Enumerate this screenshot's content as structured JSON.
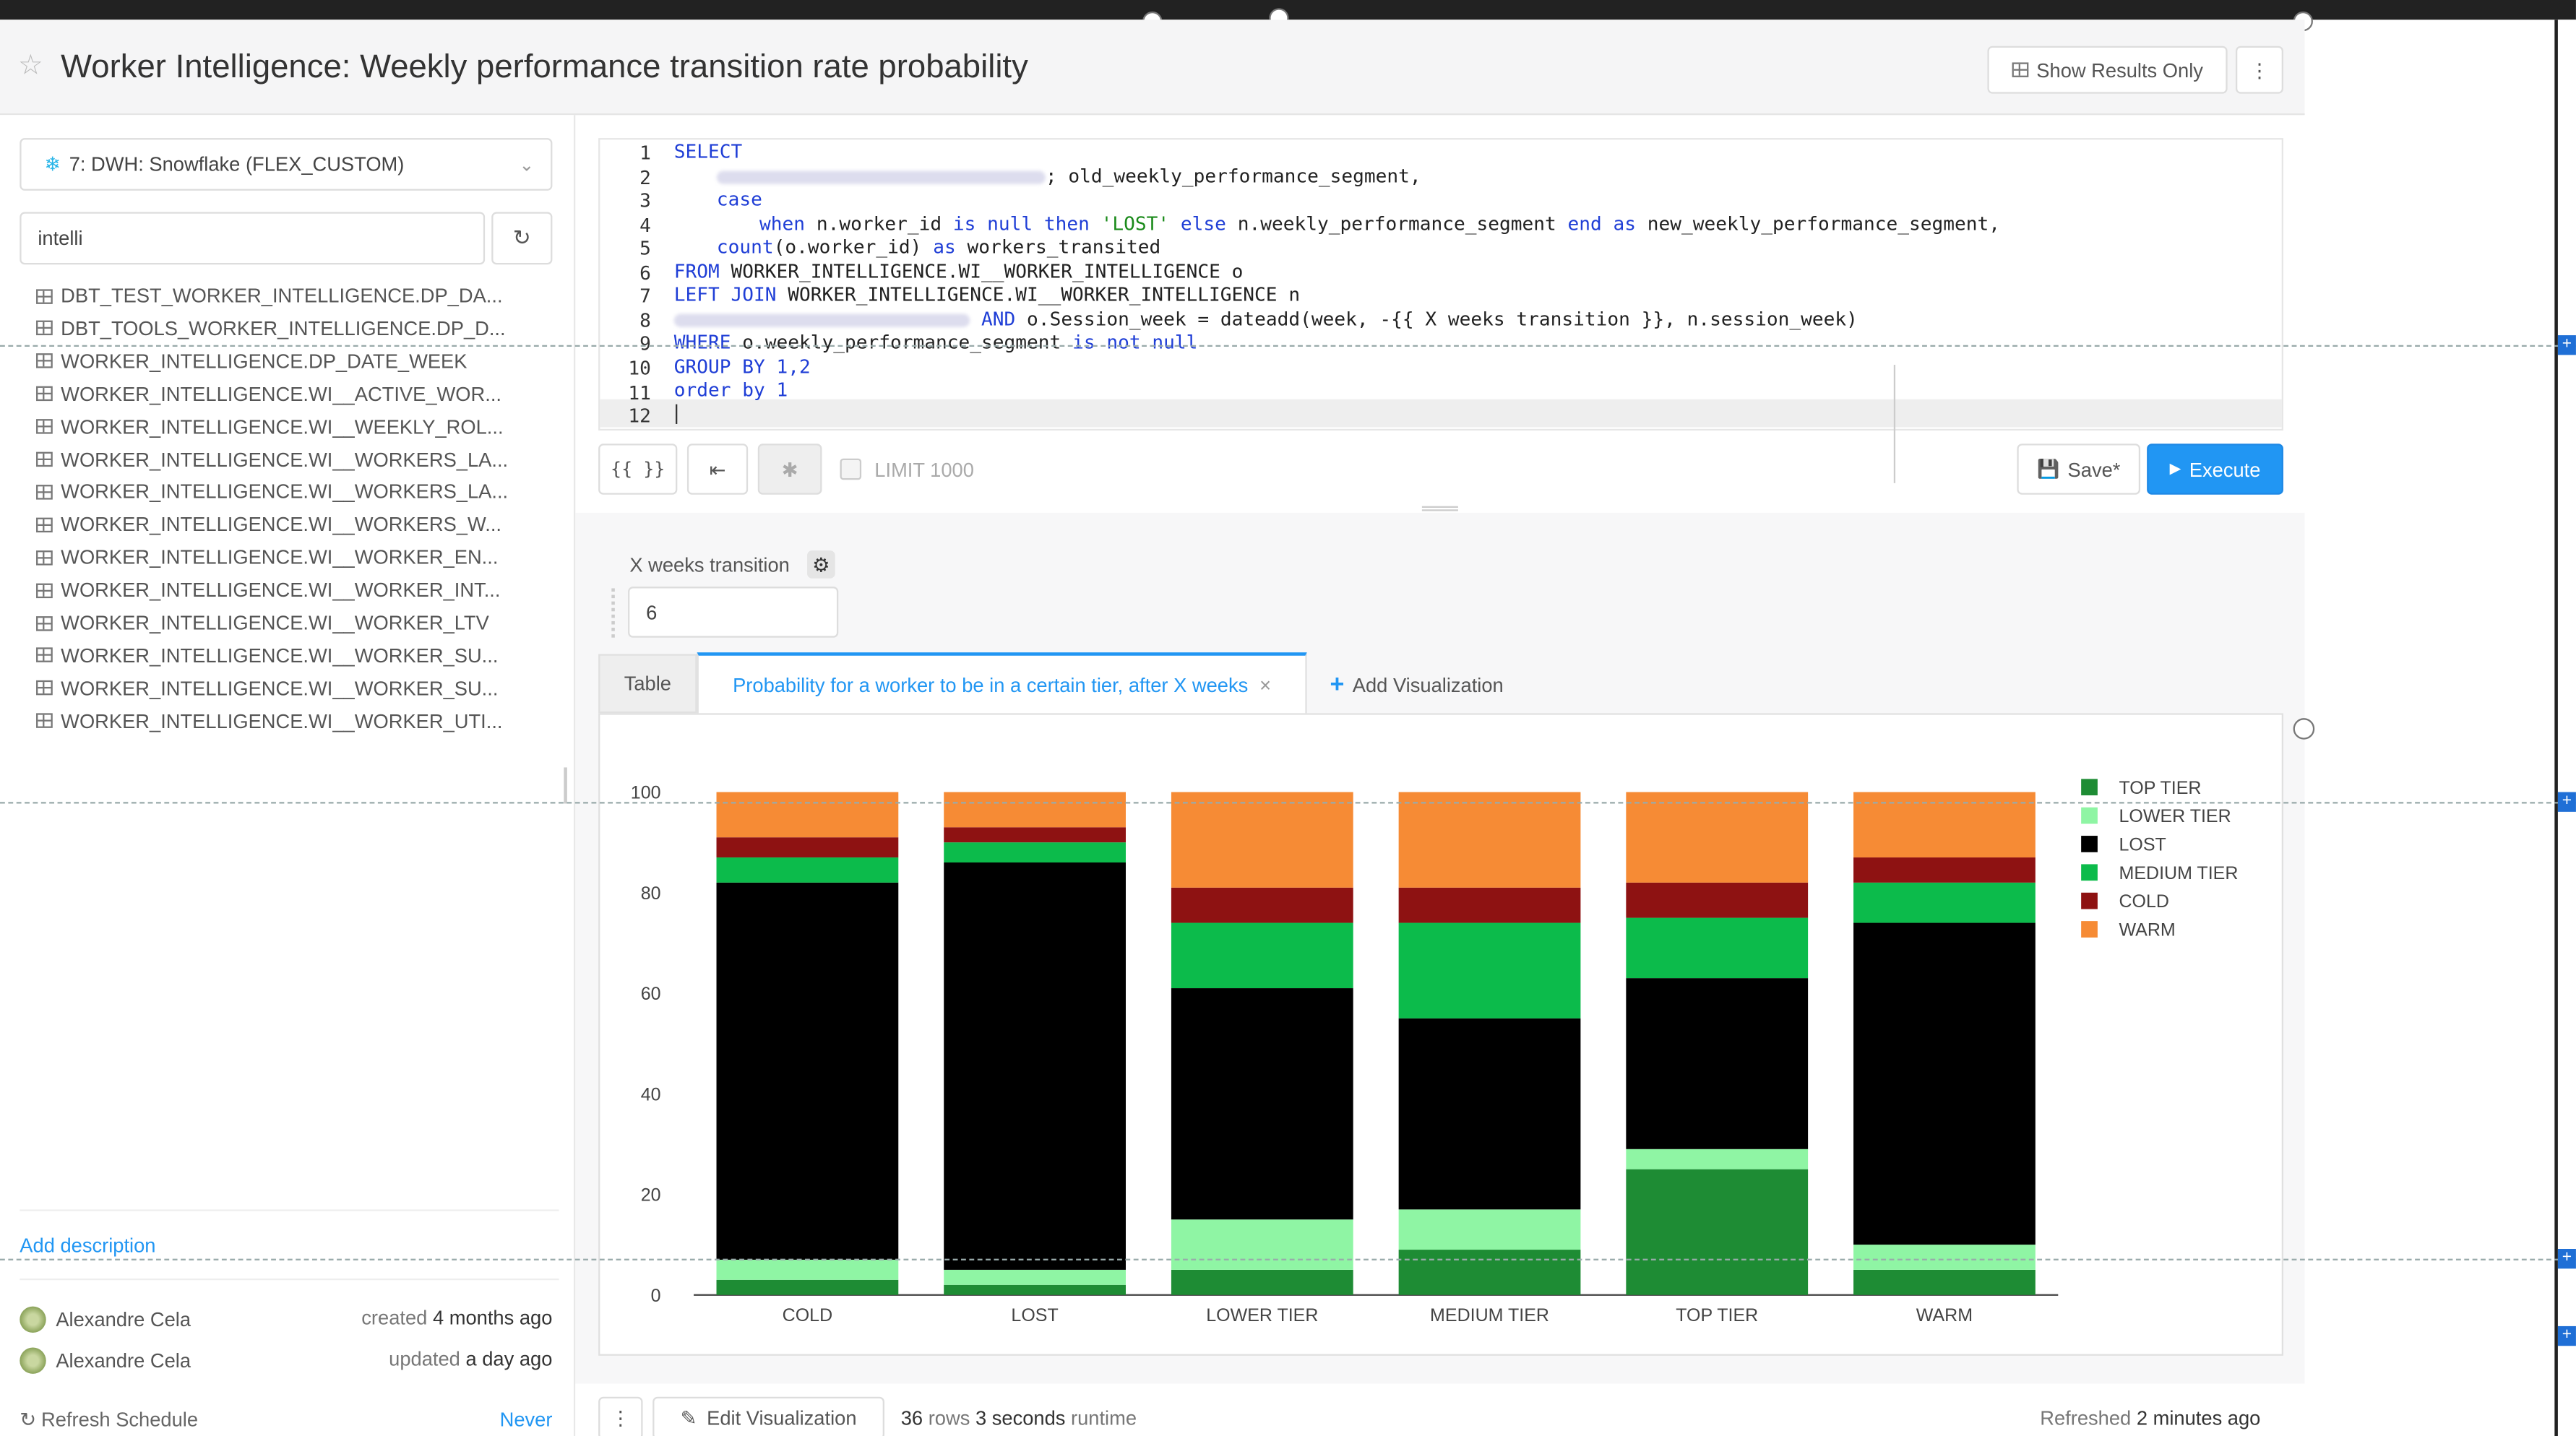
{
  "header": {
    "title": "Worker Intelligence: Weekly performance transition rate probability",
    "show_results_label": "Show Results Only",
    "more": "⋮"
  },
  "datasource": {
    "label": "7: DWH: Snowflake (FLEX_CUSTOM)"
  },
  "search": {
    "value": "intelli"
  },
  "schema": {
    "items": [
      "DBT_TEST_WORKER_INTELLIGENCE.DP_DA...",
      "DBT_TOOLS_WORKER_INTELLIGENCE.DP_D...",
      "WORKER_INTELLIGENCE.DP_DATE_WEEK",
      "WORKER_INTELLIGENCE.WI__ACTIVE_WOR...",
      "WORKER_INTELLIGENCE.WI__WEEKLY_ROL...",
      "WORKER_INTELLIGENCE.WI__WORKERS_LA...",
      "WORKER_INTELLIGENCE.WI__WORKERS_LA...",
      "WORKER_INTELLIGENCE.WI__WORKERS_W...",
      "WORKER_INTELLIGENCE.WI__WORKER_EN...",
      "WORKER_INTELLIGENCE.WI__WORKER_INT...",
      "WORKER_INTELLIGENCE.WI__WORKER_LTV",
      "WORKER_INTELLIGENCE.WI__WORKER_SU...",
      "WORKER_INTELLIGENCE.WI__WORKER_SU...",
      "WORKER_INTELLIGENCE.WI__WORKER_UTI..."
    ]
  },
  "sidebar_footer": {
    "add_description": "Add description",
    "rows": [
      {
        "user": "Alexandre Cela",
        "prefix": "created",
        "when": "4 months ago"
      },
      {
        "user": "Alexandre Cela",
        "prefix": "updated",
        "when": "a day ago"
      }
    ],
    "refresh_label": "Refresh Schedule",
    "refresh_value": "Never"
  },
  "editor": {
    "line_numbers": [
      "1",
      "2",
      "3",
      "4",
      "5",
      "6",
      "7",
      "8",
      "9",
      "10",
      "11",
      "12"
    ],
    "lines": {
      "l1_kw": "SELECT",
      "l2_text": "; old_weekly_performance_segment,",
      "l3_kw": "case",
      "l4_a": "when",
      "l4_b": " n.worker_id ",
      "l4_c": "is null then",
      "l4_d": " 'LOST' ",
      "l4_e": "else",
      "l4_f": " n.weekly_performance_segment ",
      "l4_g": "end as",
      "l4_h": " new_weekly_performance_segment,",
      "l5_a": "count",
      "l5_b": "(o.worker_id) ",
      "l5_c": "as",
      "l5_d": " workers_transited",
      "l6_a": "FROM",
      "l6_b": " WORKER_INTELLIGENCE.WI__WORKER_INTELLIGENCE o",
      "l7_a": "LEFT JOIN",
      "l7_b": " WORKER_INTELLIGENCE.WI__WORKER_INTELLIGENCE n",
      "l8_a": "AND",
      "l8_b": " o.Session_week = dateadd(week, -{{ X weeks transition }}, n.session_week)",
      "l9_a": "WHERE",
      "l9_b": " o.weekly_performance_segment ",
      "l9_c": "is not null",
      "l10_a": "GROUP BY",
      "l10_b": " 1,2",
      "l11_a": "order by",
      "l11_b": " 1"
    }
  },
  "toolbar": {
    "params_btn": "{{ }}",
    "format_btn": "⇤",
    "ai_btn": "✱",
    "limit_label": "LIMIT 1000",
    "save_label": "Save*",
    "execute_label": "Execute"
  },
  "parameter": {
    "label": "X weeks transition",
    "value": "6"
  },
  "tabs": {
    "table": "Table",
    "active": "Probability for a worker to be in a certain tier, after X weeks",
    "close": "×",
    "add": "Add Visualization"
  },
  "chart_data": {
    "type": "bar",
    "stacked": true,
    "categories": [
      "COLD",
      "LOST",
      "LOWER TIER",
      "MEDIUM TIER",
      "TOP TIER",
      "WARM"
    ],
    "ylim": [
      0,
      100
    ],
    "yticks": [
      "0",
      "20",
      "40",
      "60",
      "80",
      "100"
    ],
    "legend_position": "right",
    "series": [
      {
        "name": "TOP TIER",
        "color": "#1e8c34",
        "values": [
          3,
          2,
          5,
          9,
          25,
          5
        ]
      },
      {
        "name": "LOWER TIER",
        "color": "#8ff5a4",
        "values": [
          4,
          3,
          10,
          8,
          4,
          5
        ]
      },
      {
        "name": "LOST",
        "color": "#000000",
        "values": [
          75,
          81,
          46,
          38,
          34,
          64
        ]
      },
      {
        "name": "MEDIUM TIER",
        "color": "#0cbb4b",
        "values": [
          5,
          4,
          13,
          19,
          12,
          8
        ]
      },
      {
        "name": "COLD",
        "color": "#8e1212",
        "values": [
          4,
          3,
          7,
          7,
          7,
          5
        ]
      },
      {
        "name": "WARM",
        "color": "#f68b35",
        "values": [
          9,
          7,
          19,
          19,
          18,
          13
        ]
      }
    ]
  },
  "footer": {
    "more": "⋮",
    "edit_label": "Edit Visualization",
    "rows": "36",
    "rows_label": "rows",
    "runtime": "3 seconds",
    "runtime_label": "runtime",
    "refreshed_label": "Refreshed",
    "refreshed_value": "2 minutes ago"
  }
}
